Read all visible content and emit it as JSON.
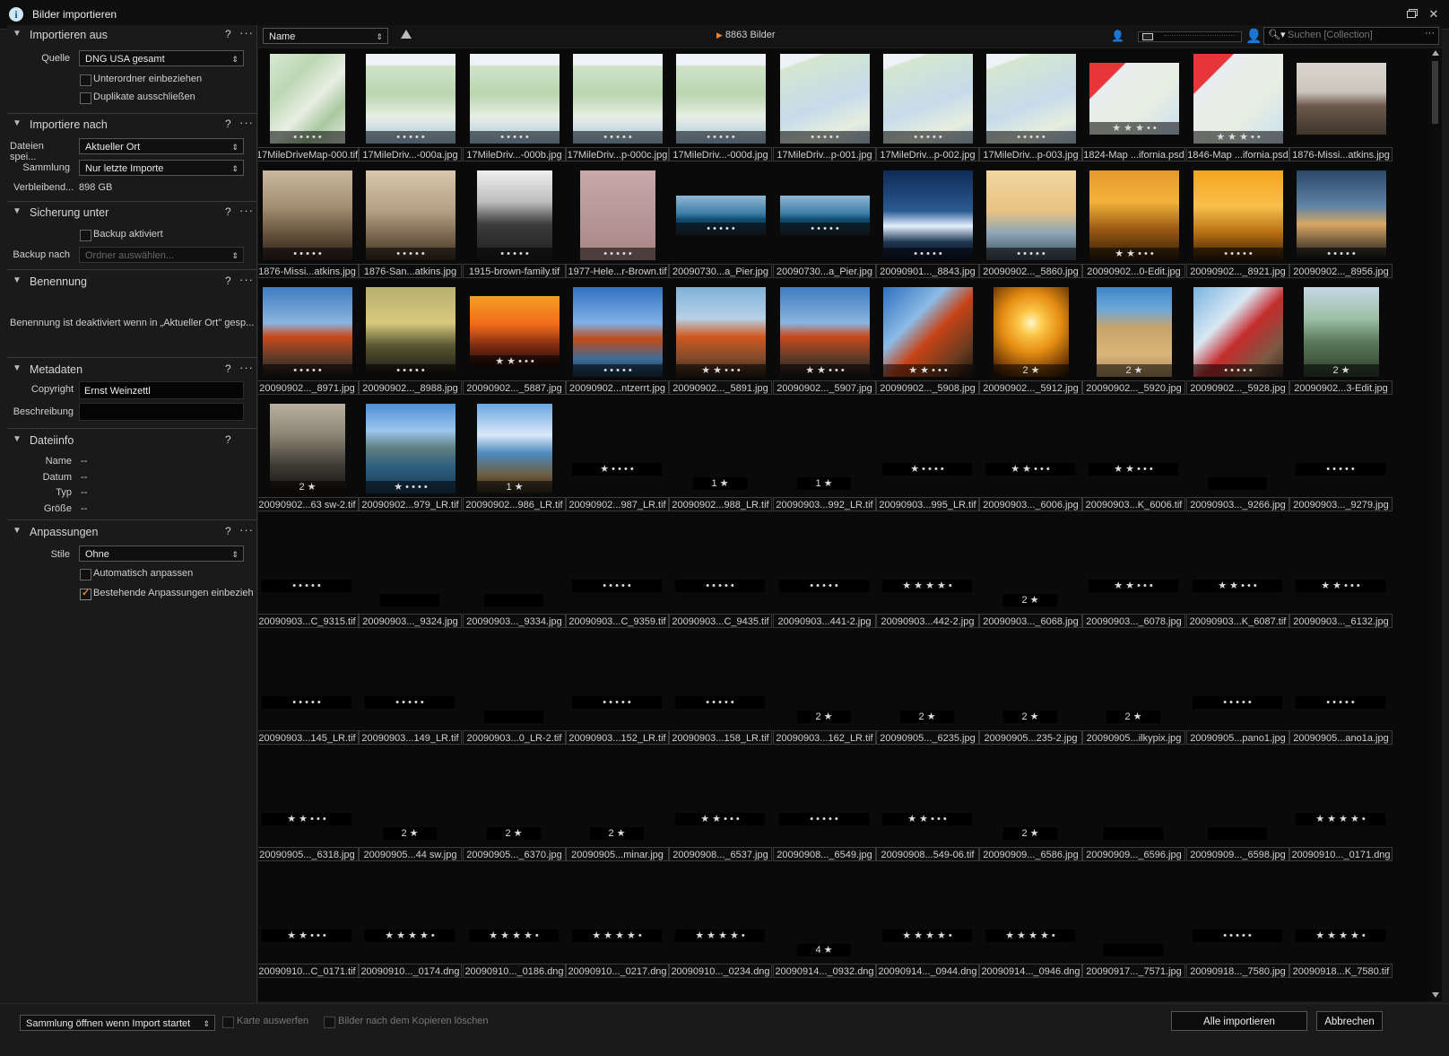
{
  "window": {
    "title": "Bilder importieren"
  },
  "left": {
    "importieren_aus": {
      "title": "Importieren aus",
      "quelle_label": "Quelle",
      "quelle_value": "DNG USA gesamt",
      "unterordner": "Unterordner einbeziehen",
      "duplikate": "Duplikate ausschließen"
    },
    "importiere_nach": {
      "title": "Importiere nach",
      "dateien_label": "Dateien spei...",
      "dateien_value": "Aktueller Ort",
      "sammlung_label": "Sammlung",
      "sammlung_value": "Nur letzte Importe",
      "verbleibend_label": "Verbleibend...",
      "verbleibend_value": "898 GB"
    },
    "sicherung": {
      "title": "Sicherung unter",
      "backup_aktiviert": "Backup aktiviert",
      "backup_nach_label": "Backup nach",
      "backup_nach_placeholder": "Ordner auswählen..."
    },
    "benennung": {
      "title": "Benennung",
      "note": "Benennung ist deaktiviert wenn in „Aktueller Ort\" gesp..."
    },
    "metadaten": {
      "title": "Metadaten",
      "copyright_label": "Copyright",
      "copyright_value": "Ernst Weinzettl",
      "beschreibung_label": "Beschreibung",
      "beschreibung_value": ""
    },
    "dateiinfo": {
      "title": "Dateiinfo",
      "rows": [
        {
          "label": "Name",
          "value": "--"
        },
        {
          "label": "Datum",
          "value": "--"
        },
        {
          "label": "Typ",
          "value": "--"
        },
        {
          "label": "Größe",
          "value": "--"
        }
      ]
    },
    "anpassungen": {
      "title": "Anpassungen",
      "stile_label": "Stile",
      "stile_value": "Ohne",
      "auto": "Automatisch anpassen",
      "bestehende": "Bestehende Anpassungen einbezieh"
    },
    "help": "?",
    "more": "···"
  },
  "toolbar": {
    "sort_value": "Name",
    "count": "8863 Bilder",
    "search_placeholder": "Suchen [Collection]"
  },
  "grid": {
    "rows": [
      [
        {
          "name": "17MileDriveMap-000.tif",
          "thumb": "map",
          "orient": "portrait",
          "rating": "• • • • •"
        },
        {
          "name": "17MileDriv...-000a.jpg",
          "thumb": "mapweb",
          "orient": "landscape",
          "rating": "• • • • •"
        },
        {
          "name": "17MileDriv...-000b.jpg",
          "thumb": "mapweb",
          "orient": "landscape",
          "rating": "• • • • •"
        },
        {
          "name": "17MileDriv...p-000c.jpg",
          "thumb": "mapweb",
          "orient": "landscape",
          "rating": "• • • • •"
        },
        {
          "name": "17MileDriv...-000d.jpg",
          "thumb": "mapweb",
          "orient": "landscape",
          "rating": "• • • • •"
        },
        {
          "name": "17MileDriv...p-001.jpg",
          "thumb": "mapweb2",
          "orient": "landscape",
          "rating": "• • • • •"
        },
        {
          "name": "17MileDriv...p-002.jpg",
          "thumb": "mapweb2",
          "orient": "landscape",
          "rating": "• • • • •"
        },
        {
          "name": "17MileDriv...p-003.jpg",
          "thumb": "mapweb2",
          "orient": "landscape",
          "rating": "• • • • •"
        },
        {
          "name": "1824-Map ...ifornia.psd",
          "thumb": "redmap",
          "orient": "wide",
          "rating": "★ ★ ★ • •"
        },
        {
          "name": "1846-Map ...ifornia.psd",
          "thumb": "redmap",
          "orient": "landscape",
          "rating": "★ ★ ★ • •"
        },
        {
          "name": "1876-Missi...atkins.jpg",
          "thumb": "mission",
          "orient": "wide",
          "rating": ""
        }
      ],
      [
        {
          "name": "1876-Missi...atkins.jpg",
          "thumb": "sepia",
          "orient": "landscape",
          "rating": "• • • • •"
        },
        {
          "name": "1876-San...atkins.jpg",
          "thumb": "sepia2",
          "orient": "landscape",
          "rating": "• • • • •"
        },
        {
          "name": "1915-brown-family.tif",
          "thumb": "bw",
          "orient": "portrait",
          "rating": "• • • • •"
        },
        {
          "name": "1977-Hele...r-Brown.tif",
          "thumb": "stone",
          "orient": "portrait",
          "rating": "• • • • •"
        },
        {
          "name": "20090730...a_Pier.jpg",
          "thumb": "pier",
          "orient": "pano",
          "rating": "• • • • •"
        },
        {
          "name": "20090730...a_Pier.jpg",
          "thumb": "pier",
          "orient": "pano",
          "rating": "• • • • •"
        },
        {
          "name": "20090901..._8843.jpg",
          "thumb": "bluesky",
          "orient": "landscape",
          "rating": "• • • • •"
        },
        {
          "name": "20090902..._5860.jpg",
          "thumb": "haze",
          "orient": "landscape",
          "rating": "• • • • •"
        },
        {
          "name": "20090902...0-Edit.jpg",
          "thumb": "sunsetorange",
          "orient": "landscape",
          "rating": "★ ★ • • •"
        },
        {
          "name": "20090902..._8921.jpg",
          "thumb": "sunsetorange2",
          "orient": "landscape",
          "rating": "• • • • •"
        },
        {
          "name": "20090902..._8956.jpg",
          "thumb": "dusk",
          "orient": "landscape",
          "rating": "• • • • •"
        }
      ],
      [
        {
          "name": "20090902..._8971.jpg",
          "thumb": "gg1",
          "orient": "landscape",
          "rating": "• • • • •"
        },
        {
          "name": "20090902..._8988.jpg",
          "thumb": "silhouette",
          "orient": "landscape",
          "rating": "• • • • •"
        },
        {
          "name": "20090902..._5887.jpg",
          "thumb": "sunsetred",
          "orient": "wide",
          "rating": "★ ★ • • •"
        },
        {
          "name": "20090902...ntzerrt.jpg",
          "thumb": "gg2",
          "orient": "landscape",
          "rating": "• • • • •"
        },
        {
          "name": "20090902..._5891.jpg",
          "thumb": "gg3",
          "orient": "landscape",
          "rating": "★ ★ • • •"
        },
        {
          "name": "20090902..._5907.jpg",
          "thumb": "gg1",
          "orient": "landscape",
          "rating": "★ ★ • • •"
        },
        {
          "name": "20090902..._5908.jpg",
          "thumb": "gg4",
          "orient": "landscape",
          "rating": "★ ★ • • •"
        },
        {
          "name": "20090902..._5912.jpg",
          "thumb": "sungold",
          "orient": "portrait",
          "rating": "2 ★"
        },
        {
          "name": "20090902..._5920.jpg",
          "thumb": "beach",
          "orient": "portrait",
          "rating": "2 ★"
        },
        {
          "name": "20090902..._5928.jpg",
          "thumb": "coastflower",
          "orient": "landscape",
          "rating": "• • • • •"
        },
        {
          "name": "20090902...3-Edit.jpg",
          "thumb": "street",
          "orient": "portrait",
          "rating": "2 ★"
        }
      ],
      [
        {
          "name": "20090902...63 sw-2.tif",
          "thumb": "bwsepia",
          "orient": "portrait",
          "rating": "2 ★"
        },
        {
          "name": "20090902...979_LR.tif",
          "thumb": "coastblue",
          "orient": "landscape",
          "rating": "★ • • • •"
        },
        {
          "name": "20090902...986_LR.tif",
          "thumb": "coastport",
          "orient": "portrait",
          "rating": "1 ★"
        },
        {
          "name": "20090902...987_LR.tif",
          "thumb": "",
          "orient": "none",
          "rating": "★ • • • •"
        },
        {
          "name": "20090902...988_LR.tif",
          "thumb": "",
          "orient": "none",
          "rating": "1 ★"
        },
        {
          "name": "20090903...992_LR.tif",
          "thumb": "",
          "orient": "none",
          "rating": "1 ★"
        },
        {
          "name": "20090903...995_LR.tif",
          "thumb": "",
          "orient": "none",
          "rating": "★ • • • •"
        },
        {
          "name": "20090903..._6006.jpg",
          "thumb": "",
          "orient": "none",
          "rating": "★ ★ • • •"
        },
        {
          "name": "20090903...K_6006.tif",
          "thumb": "",
          "orient": "none",
          "rating": "★ ★ • • •"
        },
        {
          "name": "20090903..._9266.jpg",
          "thumb": "",
          "orient": "none",
          "rating": " "
        },
        {
          "name": "20090903..._9279.jpg",
          "thumb": "",
          "orient": "none",
          "rating": "• • • • •"
        }
      ],
      [
        {
          "name": "20090903...C_9315.tif",
          "thumb": "",
          "orient": "none",
          "rating": "• • • • •"
        },
        {
          "name": "20090903..._9324.jpg",
          "thumb": "",
          "orient": "none",
          "rating": " "
        },
        {
          "name": "20090903..._9334.jpg",
          "thumb": "",
          "orient": "none",
          "rating": " "
        },
        {
          "name": "20090903...C_9359.tif",
          "thumb": "",
          "orient": "none",
          "rating": "• • • • •"
        },
        {
          "name": "20090903...C_9435.tif",
          "thumb": "",
          "orient": "none",
          "rating": "• • • • •"
        },
        {
          "name": "20090903...441-2.jpg",
          "thumb": "",
          "orient": "none",
          "rating": "• • • • •"
        },
        {
          "name": "20090903...442-2.jpg",
          "thumb": "",
          "orient": "none",
          "rating": "★ ★ ★ ★ •"
        },
        {
          "name": "20090903..._6068.jpg",
          "thumb": "",
          "orient": "none",
          "rating": "2 ★"
        },
        {
          "name": "20090903..._6078.jpg",
          "thumb": "",
          "orient": "none",
          "rating": "★ ★ • • •"
        },
        {
          "name": "20090903...K_6087.tif",
          "thumb": "",
          "orient": "none",
          "rating": "★ ★ • • •"
        },
        {
          "name": "20090903..._6132.jpg",
          "thumb": "",
          "orient": "none",
          "rating": "★ ★ • • •"
        }
      ],
      [
        {
          "name": "20090903...145_LR.tif",
          "thumb": "",
          "orient": "none",
          "rating": "• • • • •"
        },
        {
          "name": "20090903...149_LR.tif",
          "thumb": "",
          "orient": "none",
          "rating": "• • • • •"
        },
        {
          "name": "20090903...0_LR-2.tif",
          "thumb": "",
          "orient": "none",
          "rating": " "
        },
        {
          "name": "20090903...152_LR.tif",
          "thumb": "",
          "orient": "none",
          "rating": "• • • • •"
        },
        {
          "name": "20090903...158_LR.tif",
          "thumb": "",
          "orient": "none",
          "rating": "• • • • •"
        },
        {
          "name": "20090903...162_LR.tif",
          "thumb": "",
          "orient": "none",
          "rating": "2 ★"
        },
        {
          "name": "20090905..._6235.jpg",
          "thumb": "",
          "orient": "none",
          "rating": "2 ★"
        },
        {
          "name": "20090905...235-2.jpg",
          "thumb": "",
          "orient": "none",
          "rating": "2 ★"
        },
        {
          "name": "20090905...ilkypix.jpg",
          "thumb": "",
          "orient": "none",
          "rating": "2 ★"
        },
        {
          "name": "20090905...pano1.jpg",
          "thumb": "",
          "orient": "none",
          "rating": "• • • • •"
        },
        {
          "name": "20090905...ano1a.jpg",
          "thumb": "",
          "orient": "none",
          "rating": "• • • • •"
        }
      ],
      [
        {
          "name": "20090905..._6318.jpg",
          "thumb": "",
          "orient": "none",
          "rating": "★ ★ • • •"
        },
        {
          "name": "20090905...44 sw.jpg",
          "thumb": "",
          "orient": "none",
          "rating": "2 ★"
        },
        {
          "name": "20090905..._6370.jpg",
          "thumb": "",
          "orient": "none",
          "rating": "2 ★"
        },
        {
          "name": "20090905...minar.jpg",
          "thumb": "",
          "orient": "none",
          "rating": "2 ★"
        },
        {
          "name": "20090908..._6537.jpg",
          "thumb": "",
          "orient": "none",
          "rating": "★ ★ • • •"
        },
        {
          "name": "20090908..._6549.jpg",
          "thumb": "",
          "orient": "none",
          "rating": "• • • • •"
        },
        {
          "name": "20090908...549-06.tif",
          "thumb": "",
          "orient": "none",
          "rating": "★ ★ • • •"
        },
        {
          "name": "20090909..._6586.jpg",
          "thumb": "",
          "orient": "none",
          "rating": "2 ★"
        },
        {
          "name": "20090909..._6596.jpg",
          "thumb": "",
          "orient": "none",
          "rating": " "
        },
        {
          "name": "20090909..._6598.jpg",
          "thumb": "",
          "orient": "none",
          "rating": " "
        },
        {
          "name": "20090910..._0171.dng",
          "thumb": "",
          "orient": "none",
          "rating": "★ ★ ★ ★ •"
        }
      ],
      [
        {
          "name": "20090910...C_0171.tif",
          "thumb": "",
          "orient": "none",
          "rating": "★ ★ • • •"
        },
        {
          "name": "20090910..._0174.dng",
          "thumb": "",
          "orient": "none",
          "rating": "★ ★ ★ ★ •"
        },
        {
          "name": "20090910..._0186.dng",
          "thumb": "",
          "orient": "none",
          "rating": "★ ★ ★ ★ •"
        },
        {
          "name": "20090910..._0217.dng",
          "thumb": "",
          "orient": "none",
          "rating": "★ ★ ★ ★ •"
        },
        {
          "name": "20090910..._0234.dng",
          "thumb": "",
          "orient": "none",
          "rating": "★ ★ ★ ★ •"
        },
        {
          "name": "20090914..._0932.dng",
          "thumb": "",
          "orient": "none",
          "rating": "4 ★"
        },
        {
          "name": "20090914..._0944.dng",
          "thumb": "",
          "orient": "none",
          "rating": "★ ★ ★ ★ •"
        },
        {
          "name": "20090914..._0946.dng",
          "thumb": "",
          "orient": "none",
          "rating": "★ ★ ★ ★ •"
        },
        {
          "name": "20090917..._7571.jpg",
          "thumb": "",
          "orient": "none",
          "rating": " "
        },
        {
          "name": "20090918..._7580.jpg",
          "thumb": "",
          "orient": "none",
          "rating": "• • • • •"
        },
        {
          "name": "20090918...K_7580.tif",
          "thumb": "",
          "orient": "none",
          "rating": "★ ★ ★ ★ •"
        }
      ]
    ]
  },
  "bottom": {
    "open_option": "Sammlung öffnen wenn Import startet",
    "karte": "Karte auswerfen",
    "loeschen": "Bilder nach dem Kopieren löschen",
    "import_all": "Alle importieren",
    "cancel": "Abbrechen"
  },
  "colors": {
    "accent": "#e8812a",
    "panel": "#1a1a1a",
    "grid": "#0a0a0a"
  }
}
